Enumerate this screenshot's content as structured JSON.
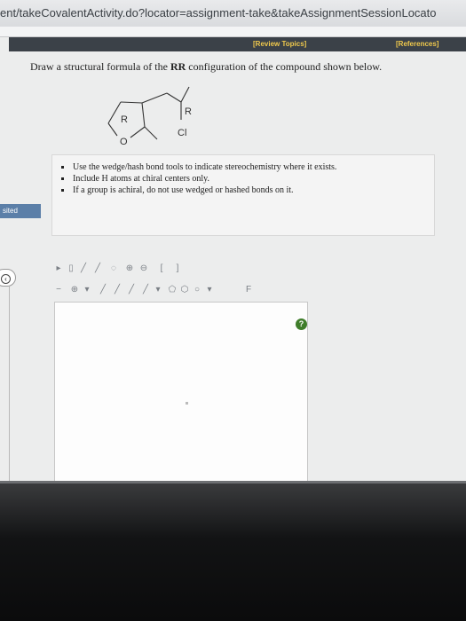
{
  "browser": {
    "url": "ent/takeCovalentActivity.do?locator=assignment-take&takeAssignmentSessionLocato"
  },
  "header": {
    "review_topics": "[Review Topics]",
    "references": "[References]"
  },
  "question": {
    "prefix": "Draw a structural formula of the ",
    "config": "RR",
    "suffix": " configuration of the compound shown below."
  },
  "molecule": {
    "label_r1": "R",
    "label_r2": "R",
    "label_o": "O",
    "label_cl": "Cl"
  },
  "hints": [
    "Use the wedge/hash bond tools to indicate stereochemistry where it exists.",
    "Include H atoms at chiral centers only.",
    "If a group is achiral, do not use wedged or hashed bonds on it."
  ],
  "side_tab": {
    "label": "sited"
  },
  "toolbar": {
    "row1": [
      "pointer",
      "eraser",
      "pencil",
      "pencil-alt",
      "lasso",
      "zoom-in",
      "zoom-out",
      "bracket",
      "bracket-alt"
    ],
    "row2": [
      "minus",
      "charge",
      "dropdown",
      "single-bond",
      "wedge-bond",
      "hash-bond",
      "double-bond",
      "chain-dropdown",
      "ring-cyclopentane",
      "ring-hexagon",
      "ring-cyclohexane",
      "ring-dropdown",
      "atom"
    ]
  },
  "editor": {
    "help_label": "?"
  },
  "colors": {
    "header_bg": "#3b4148",
    "header_text": "#f0c94c",
    "help_green": "#3f7d2a",
    "side_tab_blue": "#5b7fa8"
  }
}
